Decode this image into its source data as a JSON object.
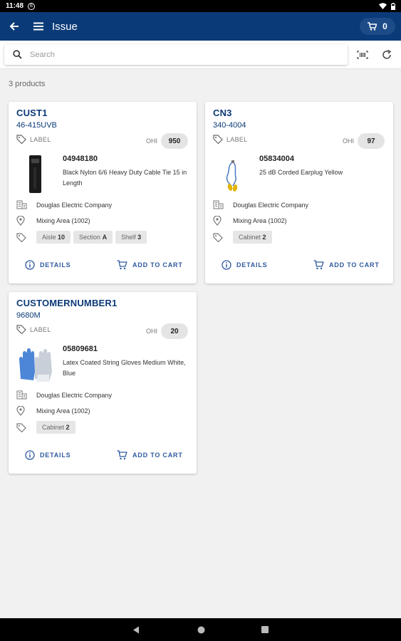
{
  "status_bar": {
    "time": "11:48",
    "notif": "B"
  },
  "app_bar": {
    "title": "Issue",
    "cart_count": "0"
  },
  "search": {
    "placeholder": "Search"
  },
  "results": {
    "count_text": "3 products"
  },
  "products": [
    {
      "name": "CUST1",
      "code": "46-415UVB",
      "label": "LABEL",
      "ohi_label": "OHI",
      "ohi_value": "950",
      "number": "04948180",
      "description": "Black Nylon 6/6 Heavy Duty Cable Tie 15 in Length",
      "company": "Douglas Electric Company",
      "location": "Mixing Area (1002)",
      "tags": [
        {
          "key": "Aisle",
          "value": "10"
        },
        {
          "key": "Section",
          "value": "A"
        },
        {
          "key": "Shelf",
          "value": "3"
        }
      ],
      "details_label": "DETAILS",
      "cart_label": "ADD TO CART",
      "image_icon": "cable-tie-image"
    },
    {
      "name": "CN3",
      "code": "340-4004",
      "label": "LABEL",
      "ohi_label": "OHI",
      "ohi_value": "97",
      "number": "05834004",
      "description": "25 dB Corded Earplug Yellow",
      "company": "Douglas Electric Company",
      "location": "Mixing Area (1002)",
      "tags": [
        {
          "key": "Cabinet",
          "value": "2"
        }
      ],
      "details_label": "DETAILS",
      "cart_label": "ADD TO CART",
      "image_icon": "earplug-image"
    },
    {
      "name": "CUSTOMERNUMBER1",
      "code": "9680M",
      "label": "LABEL",
      "ohi_label": "OHI",
      "ohi_value": "20",
      "number": "05809681",
      "description": "Latex Coated String Gloves Medium White, Blue",
      "company": "Douglas Electric Company",
      "location": "Mixing Area (1002)",
      "tags": [
        {
          "key": "Cabinet",
          "value": "2"
        }
      ],
      "details_label": "DETAILS",
      "cart_label": "ADD TO CART",
      "image_icon": "gloves-image"
    }
  ],
  "colors": {
    "primary": "#0b3a78",
    "accent": "#2f5a9e",
    "background": "#f1f1f1"
  }
}
